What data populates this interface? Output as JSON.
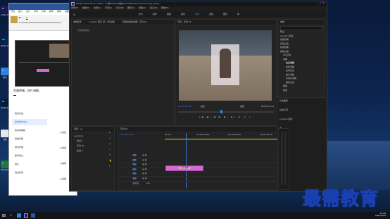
{
  "desktop_icons": [
    {
      "label": "Adobe Pr",
      "color": "#1a1a5a",
      "glyph": "Pr"
    },
    {
      "label": "Adobe Au",
      "color": "#00264d",
      "glyph": "Au"
    },
    {
      "label": "腾讯",
      "color": "#2a83e6",
      "glyph": "Q"
    },
    {
      "label": "Adobe Ps",
      "color": "#001f35",
      "glyph": "Ps"
    },
    {
      "label": "谷歌",
      "color": "#e8e8e8",
      "glyph": "G"
    },
    {
      "label": "Camtasia",
      "color": "#1f7a3a",
      "glyph": "C"
    }
  ],
  "word": {
    "tabs": [
      "开始",
      "插入",
      "设计",
      "布局",
      "引用",
      "邮件",
      "审阅",
      "视图"
    ],
    "heading": "完美拼接，拼片溶解。",
    "menu": [
      {
        "label": "我的作品",
        "active": false
      },
      {
        "label": "我的创作中心",
        "active": true
      },
      {
        "label": "我的草稿箱",
        "active": false
      },
      {
        "label": "稿箱管理",
        "active": false
      },
      {
        "label": "财务管理",
        "active": false
      },
      {
        "label": "账号安全",
        "active": false
      },
      {
        "label": "其它",
        "active": false
      },
      {
        "label": "退出登录",
        "active": false
      }
    ],
    "side_items": [
      "pr创建",
      "pr创建",
      "pr编辑",
      "pr剪辑"
    ]
  },
  "premiere": {
    "title": "Adobe Premiere Pro 2020 - C:\\用户\\Mac\\文档\\Adobe\\Premiere Pro\\14.0\\yy.prproj *",
    "menubar": [
      "文件(F)",
      "编辑(E)",
      "剪辑(C)",
      "序列(S)",
      "标记(M)",
      "图形(G)",
      "视图(V)",
      "窗口(W)",
      "帮助(H)"
    ],
    "workspaces": [
      "学习",
      "组件",
      "编辑",
      "颜色",
      "效果",
      "音频",
      "图形",
      "库"
    ],
    "active_workspace": "效果",
    "source_tabs": [
      "效果控件",
      "Lumetri 范围",
      "源：(无剪辑)",
      "音频剪辑混合器：序列 01"
    ],
    "source_placeholder": "（未选择剪辑）",
    "program_title": "节目：序列 01",
    "timecode_left": "00:00:01:09",
    "timecode_right": "00:00:02:24",
    "fit_label": "适合",
    "quality_label": "完整",
    "effects_panel_title": "效果",
    "effects_tree": [
      {
        "label": "预设",
        "level": 0
      },
      {
        "label": "Lumetri 预设",
        "level": 0
      },
      {
        "label": "音频效果",
        "level": 0
      },
      {
        "label": "音频过渡",
        "level": 0
      },
      {
        "label": "视频效果",
        "level": 0
      },
      {
        "label": "视频过渡",
        "level": 0
      },
      {
        "label": "3D 运动",
        "level": 1
      },
      {
        "label": "溶解",
        "level": 1
      },
      {
        "label": "交叉溶解",
        "level": 2
      },
      {
        "label": "叠加溶解",
        "level": 2
      },
      {
        "label": "白场过渡",
        "level": 2
      },
      {
        "label": "胶片溶解",
        "level": 2
      },
      {
        "label": "非叠加溶解",
        "level": 2
      },
      {
        "label": "黑场过渡",
        "level": 2
      },
      {
        "label": "擦除",
        "level": 1
      },
      {
        "label": "缩放",
        "level": 1
      }
    ],
    "side_sections": [
      "基本图形",
      "基本声音",
      "Lumetri 颜色",
      "库",
      "标记",
      "历史记录",
      "信息"
    ],
    "project_title": "项目：yy",
    "project_items": [
      "yy.prproj",
      "素材 1",
      "序列 01",
      "素材 2"
    ],
    "timeline_title": "序列 01",
    "timeline_timecode": "00:00:01:09",
    "tracks_video": [
      "V3",
      "V2",
      "V1"
    ],
    "tracks_audio": [
      "A1",
      "A2",
      "A3"
    ],
    "master_label": "主声道",
    "master_value": "0.0",
    "clip_label": "交叉溶解",
    "ruler_labels": [
      "00:00",
      "00:00:05:00",
      "00:00:10:00",
      "00:00:15:00"
    ]
  },
  "watermark": "最需教育",
  "taskbar": {
    "time": "11:28",
    "date": "2021/10/15"
  }
}
